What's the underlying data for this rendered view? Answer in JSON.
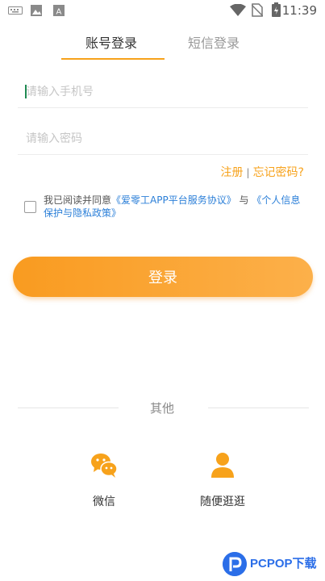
{
  "status_bar": {
    "time": "11:39",
    "icons": [
      "keyboard-icon",
      "image-icon",
      "font-icon",
      "wifi-icon",
      "no-sim-icon",
      "battery-icon"
    ]
  },
  "tabs": {
    "account_login": "账号登录",
    "sms_login": "短信登录",
    "active": "account_login",
    "accent_color": "#f7a21b"
  },
  "form": {
    "phone_placeholder": "请输入手机号",
    "password_placeholder": "请输入密码"
  },
  "links": {
    "register": "注册",
    "separator": "|",
    "forgot_password": "忘记密码?"
  },
  "agreement": {
    "checked": false,
    "prefix": "我已阅读并同意",
    "service_agreement": "《爱零工APP平台服务协议》",
    "conjunction": "与",
    "privacy_policy": "《个人信息保护与隐私政策》"
  },
  "login_button": {
    "label": "登录"
  },
  "other": {
    "label": "其他",
    "wechat": "微信",
    "browse": "随便逛逛"
  },
  "watermark": {
    "text": "PCPOP下载"
  }
}
